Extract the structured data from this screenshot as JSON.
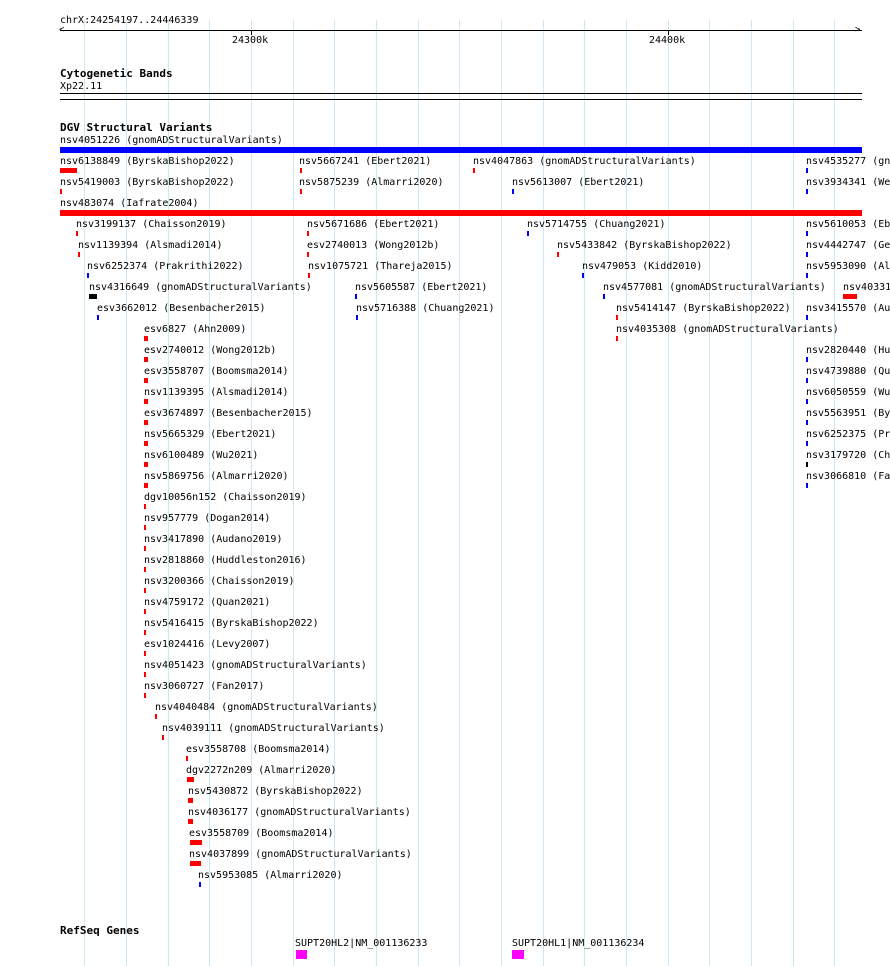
{
  "ruler": {
    "coords": "chrX:24254197..24446339",
    "tick1": "24300k",
    "tick2": "24400k"
  },
  "tracks": {
    "cyto": {
      "title": "Cytogenetic Bands",
      "band": "Xp22.11"
    },
    "dgv": {
      "title": "DGV Structural Variants"
    },
    "refseq": {
      "title": "RefSeq Genes"
    }
  },
  "colors": {
    "loss": "#ff0000",
    "gain": "#0000ff",
    "complex": "#000000",
    "gene": "#ff00ff",
    "grid": "#cfe6f5"
  },
  "dgv_items": [
    {
      "label": "nsv4051226 (gnomADStructuralVariants)",
      "color": "gain"
    },
    {
      "label": "nsv6138849 (ByrskaBishop2022)",
      "color": "loss"
    },
    {
      "label": "nsv5667241 (Ebert2021)",
      "color": "loss"
    },
    {
      "label": "nsv4047863 (gnomADStructuralVariants)",
      "color": "loss"
    },
    {
      "label": "nsv4535277 (gn",
      "color": "gain"
    },
    {
      "label": "nsv5419003 (ByrskaBishop2022)",
      "color": "loss"
    },
    {
      "label": "nsv5875239 (Almarri2020)",
      "color": "loss"
    },
    {
      "label": "nsv5613007 (Ebert2021)",
      "color": "gain"
    },
    {
      "label": "nsv3934341 (We",
      "color": "gain"
    },
    {
      "label": "nsv483074 (Iafrate2004)",
      "color": "loss"
    },
    {
      "label": "nsv3199137 (Chaisson2019)",
      "color": "loss"
    },
    {
      "label": "nsv5671686 (Ebert2021)",
      "color": "loss"
    },
    {
      "label": "nsv5714755 (Chuang2021)",
      "color": "gain"
    },
    {
      "label": "nsv5610053 (Eb",
      "color": "gain"
    },
    {
      "label": "nsv1139394 (Alsmadi2014)",
      "color": "loss"
    },
    {
      "label": "esv2740013 (Wong2012b)",
      "color": "loss"
    },
    {
      "label": "nsv5433842 (ByrskaBishop2022)",
      "color": "loss"
    },
    {
      "label": "nsv4442747 (Ge",
      "color": "gain"
    },
    {
      "label": "nsv6252374 (Prakrithi2022)",
      "color": "gain"
    },
    {
      "label": "nsv1075721 (Thareja2015)",
      "color": "loss"
    },
    {
      "label": "nsv479053 (Kidd2010)",
      "color": "gain"
    },
    {
      "label": "nsv5953090 (Al",
      "color": "gain"
    },
    {
      "label": "nsv4316649 (gnomADStructuralVariants)",
      "color": "complex"
    },
    {
      "label": "nsv5605587 (Ebert2021)",
      "color": "gain"
    },
    {
      "label": "nsv4577081 (gnomADStructuralVariants)",
      "color": "gain"
    },
    {
      "label": "nsv40331",
      "color": "loss"
    },
    {
      "label": "esv3662012 (Besenbacher2015)",
      "color": "gain"
    },
    {
      "label": "nsv5716388 (Chuang2021)",
      "color": "gain"
    },
    {
      "label": "nsv5414147 (ByrskaBishop2022)",
      "color": "loss"
    },
    {
      "label": "nsv3415570 (Au",
      "color": "gain"
    },
    {
      "label": "esv6827 (Ahn2009)",
      "color": "loss"
    },
    {
      "label": "nsv4035308 (gnomADStructuralVariants)",
      "color": "loss"
    },
    {
      "label": "esv2740012 (Wong2012b)",
      "color": "loss"
    },
    {
      "label": "nsv2820440 (Hu",
      "color": "gain"
    },
    {
      "label": "esv3558707 (Boomsma2014)",
      "color": "loss"
    },
    {
      "label": "nsv4739880 (Qu",
      "color": "gain"
    },
    {
      "label": "nsv1139395 (Alsmadi2014)",
      "color": "loss"
    },
    {
      "label": "nsv6050559 (Wu",
      "color": "gain"
    },
    {
      "label": "esv3674897 (Besenbacher2015)",
      "color": "loss"
    },
    {
      "label": "nsv5563951 (By",
      "color": "gain"
    },
    {
      "label": "nsv5665329 (Ebert2021)",
      "color": "loss"
    },
    {
      "label": "nsv6252375 (Pr",
      "color": "gain"
    },
    {
      "label": "nsv6100489 (Wu2021)",
      "color": "loss"
    },
    {
      "label": "nsv3179720 (Ch",
      "color": "complex"
    },
    {
      "label": "nsv5869756 (Almarri2020)",
      "color": "loss"
    },
    {
      "label": "nsv3066810 (Fa",
      "color": "gain"
    },
    {
      "label": "dgv10056n152 (Chaisson2019)",
      "color": "loss"
    },
    {
      "label": "nsv957779 (Dogan2014)",
      "color": "loss"
    },
    {
      "label": "nsv3417890 (Audano2019)",
      "color": "loss"
    },
    {
      "label": "nsv2818860 (Huddleston2016)",
      "color": "loss"
    },
    {
      "label": "nsv3200366 (Chaisson2019)",
      "color": "loss"
    },
    {
      "label": "nsv4759172 (Quan2021)",
      "color": "loss"
    },
    {
      "label": "nsv5416415 (ByrskaBishop2022)",
      "color": "loss"
    },
    {
      "label": "esv1024416 (Levy2007)",
      "color": "loss"
    },
    {
      "label": "nsv4051423 (gnomADStructuralVariants)",
      "color": "loss"
    },
    {
      "label": "nsv3060727 (Fan2017)",
      "color": "loss"
    },
    {
      "label": "nsv4040484 (gnomADStructuralVariants)",
      "color": "loss"
    },
    {
      "label": "nsv4039111 (gnomADStructuralVariants)",
      "color": "loss"
    },
    {
      "label": "esv3558708 (Boomsma2014)",
      "color": "loss"
    },
    {
      "label": "dgv2272n209 (Almarri2020)",
      "color": "loss"
    },
    {
      "label": "nsv5430872 (ByrskaBishop2022)",
      "color": "loss"
    },
    {
      "label": "nsv4036177 (gnomADStructuralVariants)",
      "color": "loss"
    },
    {
      "label": "esv3558709 (Boomsma2014)",
      "color": "loss"
    },
    {
      "label": "nsv4037899 (gnomADStructuralVariants)",
      "color": "loss"
    },
    {
      "label": "nsv5953085 (Almarri2020)",
      "color": "gain"
    }
  ],
  "genes": [
    {
      "label": "SUPT20HL2|NM_001136233"
    },
    {
      "label": "SUPT20HL1|NM_001136234"
    }
  ]
}
